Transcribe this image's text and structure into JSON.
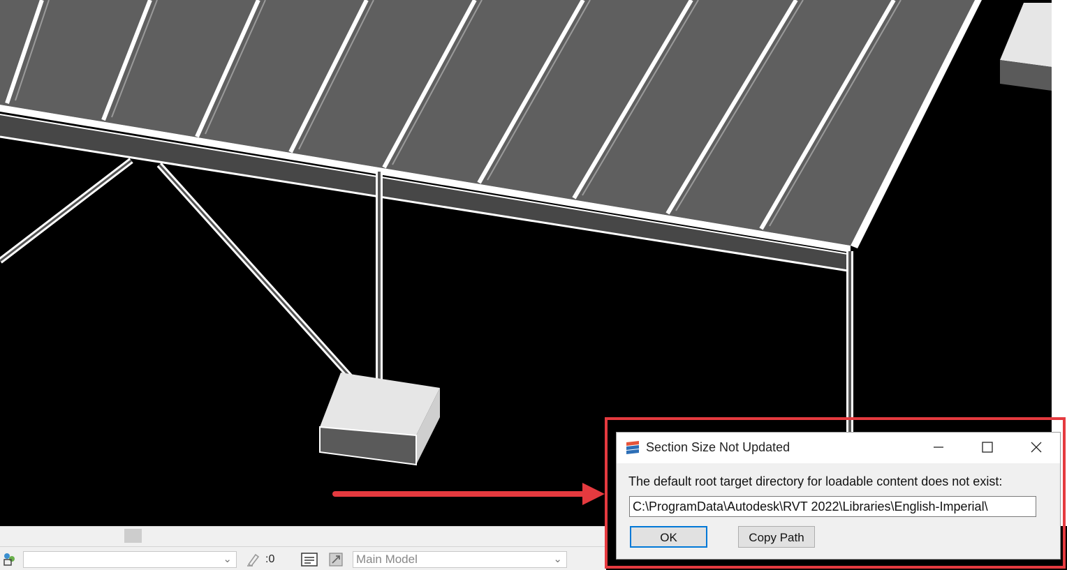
{
  "dialog": {
    "title": "Section Size Not Updated",
    "message": "The default root target directory for loadable content does not exist:",
    "path_value": "C:\\ProgramData\\Autodesk\\RVT 2022\\Libraries\\English-Imperial\\",
    "ok_label": "OK",
    "copy_path_label": "Copy Path"
  },
  "statusbar": {
    "workset_value": "",
    "editable_count": ":0",
    "model_value": "Main Model"
  },
  "colors": {
    "highlight_outline": "#e53a3f",
    "arrow": "#e53a3f",
    "default_button_border": "#0078d7"
  },
  "icons": [
    "revit-app-icon",
    "minimize-icon",
    "maximize-icon",
    "close-icon",
    "workset-icon",
    "editable-icon",
    "model-icon",
    "filter-icon",
    "chevron-down-icon"
  ]
}
